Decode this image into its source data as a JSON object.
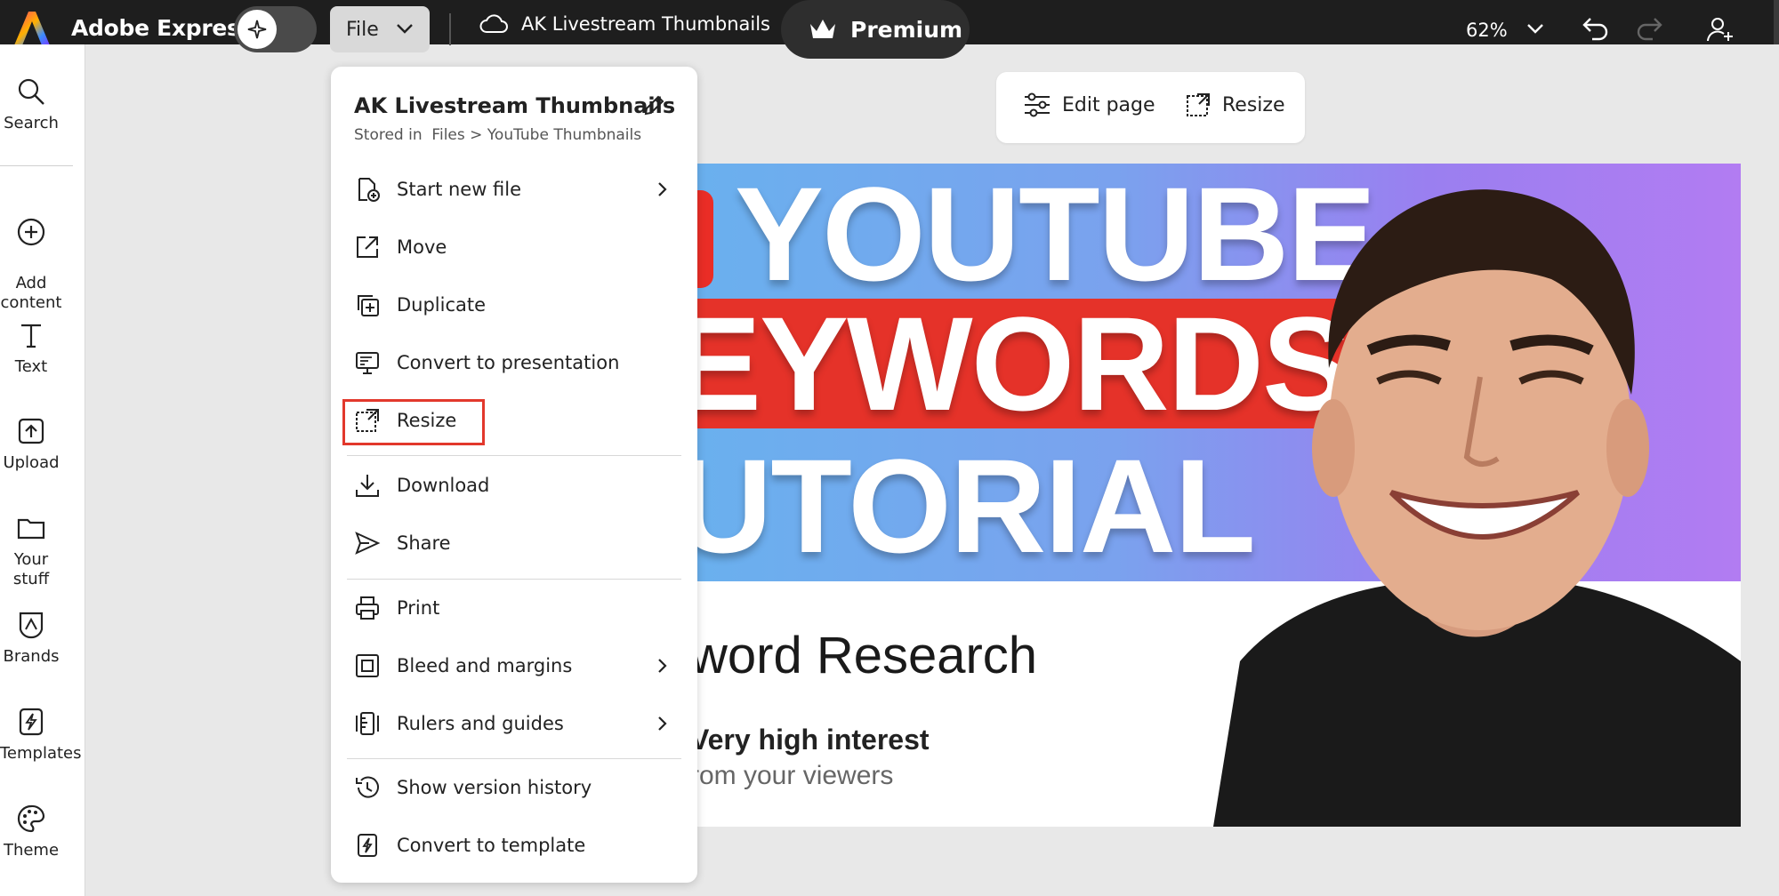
{
  "topbar": {
    "app_name": "Adobe Express",
    "file_label": "File",
    "document_title": "AK Livestream Thumbnails",
    "premium_label": "Premium",
    "zoom": "62%"
  },
  "rail": {
    "items": [
      {
        "label": "Search",
        "icon": "search-icon"
      },
      {
        "label": "Add\ncontent",
        "icon": "add-icon"
      },
      {
        "label": "Text",
        "icon": "text-icon"
      },
      {
        "label": "Upload",
        "icon": "upload-icon"
      },
      {
        "label": "Your stuff",
        "icon": "folder-icon"
      },
      {
        "label": "Brands",
        "icon": "brand-icon"
      },
      {
        "label": "Templates",
        "icon": "templates-icon"
      },
      {
        "label": "Theme",
        "icon": "palette-icon"
      }
    ]
  },
  "page_toolbar": {
    "edit_page": "Edit page",
    "resize": "Resize"
  },
  "file_menu": {
    "title": "AK Livestream Thumbnails",
    "stored_in": "Stored in  Files > YouTube Thumbnails",
    "items": [
      {
        "label": "Start new file",
        "icon": "new-file-icon",
        "submenu": true
      },
      {
        "label": "Move",
        "icon": "move-icon"
      },
      {
        "label": "Duplicate",
        "icon": "duplicate-icon"
      },
      {
        "label": "Convert to presentation",
        "icon": "presentation-icon"
      },
      {
        "label": "Resize",
        "icon": "resize-icon",
        "highlighted": true
      },
      {
        "label": "Download",
        "icon": "download-icon"
      },
      {
        "label": "Share",
        "icon": "share-icon"
      },
      {
        "label": "Print",
        "icon": "print-icon"
      },
      {
        "label": "Bleed and margins",
        "icon": "bleed-icon",
        "submenu": true
      },
      {
        "label": "Rulers and guides",
        "icon": "ruler-icon",
        "submenu": true
      },
      {
        "label": "Show version history",
        "icon": "history-icon"
      },
      {
        "label": "Convert to template",
        "icon": "template-icon"
      }
    ]
  },
  "artboard": {
    "line1": "YOUTUBE",
    "line2": "EYWORDS",
    "line3": "UTORIAL",
    "subheading": "word Research",
    "bullet1": "Very high interest",
    "bullet2": "rom your viewers"
  },
  "colors": {
    "topbar": "#1e1e1e",
    "highlight": "#e2382c",
    "banner_red": "#e53229"
  }
}
